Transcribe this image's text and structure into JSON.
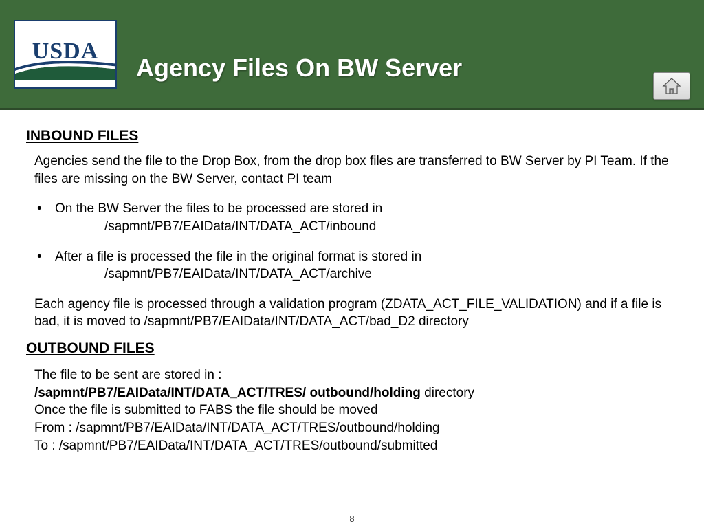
{
  "header": {
    "logo_text": "USDA",
    "title": "Agency Files On BW Server"
  },
  "inbound": {
    "heading": "INBOUND FILES",
    "intro": "Agencies send the file to the Drop Box, from the drop box files are transferred to BW Server by PI Team. If the files are missing on the BW Server, contact PI team",
    "bullet1_text": "On the BW Server the files to be processed are stored in",
    "bullet1_path": "/sapmnt/PB7/EAIData/INT/DATA_ACT/inbound",
    "bullet2_text": "After a file is processed the file in the original format is stored in",
    "bullet2_path": "/sapmnt/PB7/EAIData/INT/DATA_ACT/archive",
    "validation": "Each agency file is processed through a validation program (ZDATA_ACT_FILE_VALIDATION) and if a file is bad, it is moved to /sapmnt/PB7/EAIData/INT/DATA_ACT/bad_D2 directory"
  },
  "outbound": {
    "heading": "OUTBOUND FILES",
    "line1": "The file to be sent are stored in :",
    "line2_bold": "/sapmnt/PB7/EAIData/INT/DATA_ACT/TRES/ outbound/holding",
    "line2_rest": " directory",
    "line3": "Once the file is submitted to FABS the file should be moved",
    "line4": "From : /sapmnt/PB7/EAIData/INT/DATA_ACT/TRES/outbound/holding",
    "line5": "To : /sapmnt/PB7/EAIData/INT/DATA_ACT/TRES/outbound/submitted"
  },
  "page_number": "8"
}
